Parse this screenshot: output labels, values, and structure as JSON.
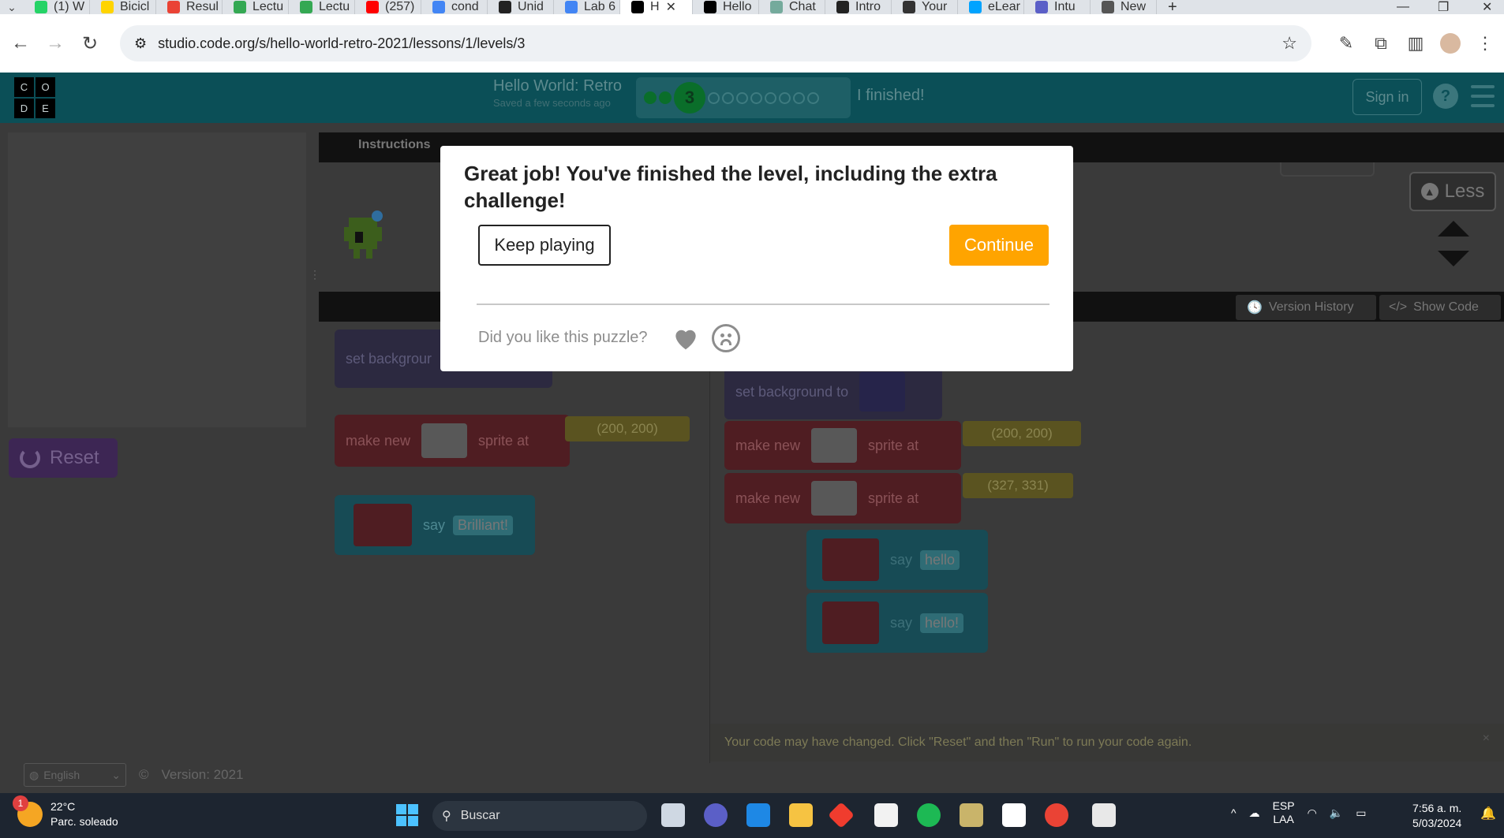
{
  "browser": {
    "tabs": [
      {
        "label": "(1) W",
        "color": "#25d366"
      },
      {
        "label": "Bicicl",
        "color": "#ffd400"
      },
      {
        "label": "Resul",
        "color": "#ea4335"
      },
      {
        "label": "Lectu",
        "color": "#34a853"
      },
      {
        "label": "Lectu",
        "color": "#34a853"
      },
      {
        "label": "(257)",
        "color": "#ff0000"
      },
      {
        "label": "cond",
        "color": "#4285f4"
      },
      {
        "label": "Unid",
        "color": "#222222"
      },
      {
        "label": "Lab 6",
        "color": "#4285f4"
      },
      {
        "label": "H",
        "color": "#000000",
        "active": true
      },
      {
        "label": "Hello",
        "color": "#000000"
      },
      {
        "label": "Chat",
        "color": "#74aa9c"
      },
      {
        "label": "Intro",
        "color": "#222222"
      },
      {
        "label": "Your",
        "color": "#333333"
      },
      {
        "label": "eLear",
        "color": "#00a3ff"
      },
      {
        "label": "Intu",
        "color": "#5b5fc7"
      },
      {
        "label": "New",
        "color": "#555555"
      }
    ],
    "url": "studio.code.org/s/hello-world-retro-2021/lessons/1/levels/3"
  },
  "header": {
    "logo": [
      "C",
      "O",
      "D",
      "E"
    ],
    "project_title": "Hello World: Retro",
    "saved_status": "Saved a few seconds ago",
    "current_level": "3",
    "finished_label": "I finished!",
    "sign_in": "Sign in",
    "help": "?"
  },
  "sidebar": {
    "reset_label": "Reset",
    "language": "English",
    "version": "Version: 2021"
  },
  "instructions": {
    "tab_label": "Instructions",
    "less_label": "Less"
  },
  "workspace": {
    "version_history": "Version History",
    "show_code": "Show Code",
    "toolbox_blocks": {
      "set_background": "set backgrour",
      "make_new": "make new",
      "sprite_at": "sprite at",
      "coords": "(200, 200)",
      "say": "say",
      "say_text": "Brilliant!"
    },
    "program_blocks": {
      "set_background": "set background to",
      "make_new_1": "make new",
      "sprite_at_1": "sprite at",
      "coords_1": "(200, 200)",
      "make_new_2": "make new",
      "sprite_at_2": "sprite at",
      "coords_2": "(327, 331)",
      "say_1": "say",
      "say_1_text": "hello",
      "say_2": "say",
      "say_2_text": "hello!"
    },
    "warning": "Your code may have changed. Click \"Reset\" and then \"Run\" to run your code again."
  },
  "modal": {
    "title": "Great job! You've finished the level, including the extra challenge!",
    "keep_playing": "Keep playing",
    "continue": "Continue",
    "feedback_question": "Did you like this puzzle?",
    "continue_color": "#ffa400"
  },
  "taskbar": {
    "weather_temp": "22°C",
    "weather_desc": "Parc. soleado",
    "weather_badge": "1",
    "search_label": "Buscar",
    "lang_top": "ESP",
    "lang_bottom": "LAA",
    "time": "7:56 a. m.",
    "date": "5/03/2024"
  }
}
